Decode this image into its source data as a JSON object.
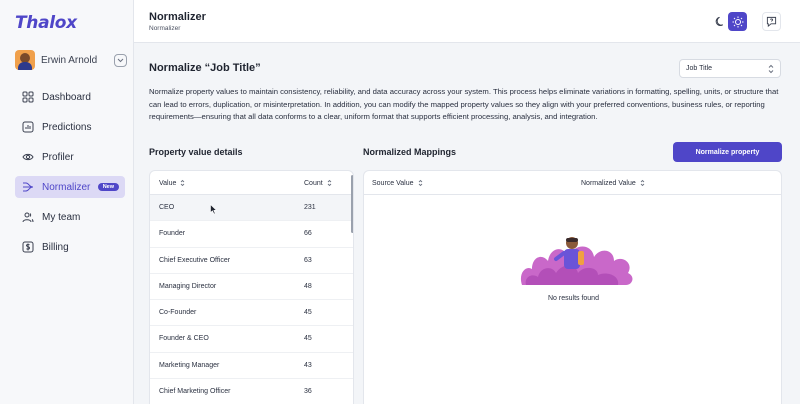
{
  "app": {
    "logo": "Thalox"
  },
  "user": {
    "name": "Erwin Arnold"
  },
  "sidebar": {
    "items": [
      {
        "label": "Dashboard",
        "icon": "grid-icon"
      },
      {
        "label": "Predictions",
        "icon": "chart-icon"
      },
      {
        "label": "Profiler",
        "icon": "eye-icon"
      },
      {
        "label": "Normalizer",
        "icon": "normalizer-icon",
        "badge": "New",
        "active": true
      },
      {
        "label": "My team",
        "icon": "team-icon"
      },
      {
        "label": "Billing",
        "icon": "dollar-icon"
      }
    ]
  },
  "header": {
    "title": "Normalizer",
    "breadcrumb": "Normalizer"
  },
  "main": {
    "title": "Normalize “Job Title”",
    "property_select": "Job Title",
    "description": "Normalize property values to maintain consistency, reliability, and data accuracy across your system. This process helps eliminate variations in formatting, spelling, units, or structure that can lead to errors, duplication, or misinterpretation. In addition, you can modify the mapped property values so they align with your preferred conventions, business rules, or reporting requirements—ensuring that all data conforms to a clear, uniform format that supports efficient processing, analysis, and integration.",
    "left_title": "Property value details",
    "right_title": "Normalized Mappings",
    "normalize_button": "Normalize property",
    "left_table": {
      "headers": [
        "Value",
        "Count"
      ],
      "rows": [
        [
          "CEO",
          "231"
        ],
        [
          "Founder",
          "66"
        ],
        [
          "Chief Executive Officer",
          "63"
        ],
        [
          "Managing Director",
          "48"
        ],
        [
          "Co-Founder",
          "45"
        ],
        [
          "Founder & CEO",
          "45"
        ],
        [
          "Marketing Manager",
          "43"
        ],
        [
          "Chief Marketing Officer",
          "36"
        ]
      ]
    },
    "right_table": {
      "headers": [
        "Source Value",
        "Normalized Value"
      ],
      "empty_text": "No results found"
    }
  },
  "colors": {
    "accent": "#4f46c8",
    "accent_soft": "#dcd9f5"
  }
}
